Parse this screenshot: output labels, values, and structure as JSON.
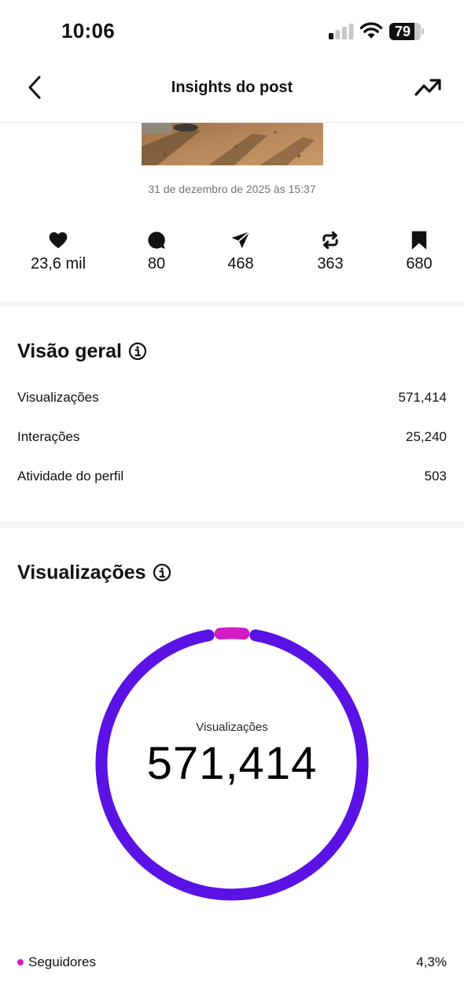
{
  "status_bar": {
    "time": "10:06",
    "battery": "79",
    "battery_level": 0.79
  },
  "header": {
    "title": "Insights do post"
  },
  "post": {
    "date": "31 de dezembro de 2025 às 15:37"
  },
  "stats": [
    {
      "icon": "heart-icon",
      "value": "23,6 mil"
    },
    {
      "icon": "comment-icon",
      "value": "80"
    },
    {
      "icon": "send-icon",
      "value": "468"
    },
    {
      "icon": "repost-icon",
      "value": "363"
    },
    {
      "icon": "bookmark-icon",
      "value": "680"
    }
  ],
  "overview": {
    "title": "Visão geral",
    "rows": [
      {
        "label": "Visualizações",
        "value": "571,414"
      },
      {
        "label": "Interações",
        "value": "25,240"
      },
      {
        "label": "Atividade do perfil",
        "value": "503"
      }
    ]
  },
  "views": {
    "title": "Visualizações",
    "center_label": "Visualizações",
    "total": "571,414",
    "legend": [
      {
        "label": "Seguidores",
        "value": "4,3%",
        "color": "#d21bc4"
      }
    ]
  },
  "chart_data": {
    "type": "pie",
    "variant": "donut",
    "series": [
      {
        "name": "Seguidores",
        "value": 4.3,
        "color": "#d21bc4"
      },
      {
        "value": 95.7,
        "color": "#5a12e5"
      }
    ]
  },
  "colors": {
    "accent_purple": "#5a12e5",
    "followers_magenta": "#d21bc4"
  }
}
